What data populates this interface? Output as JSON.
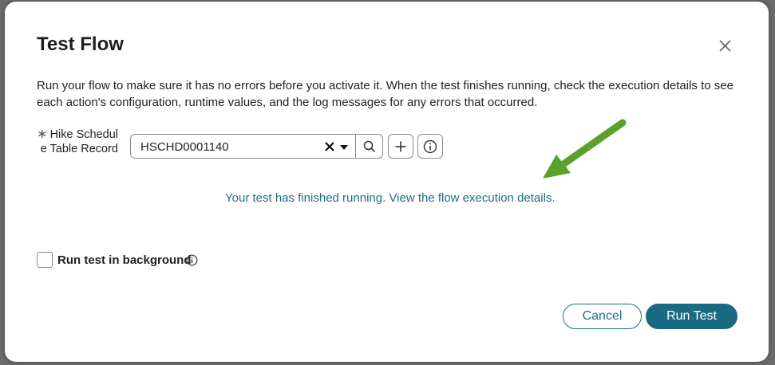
{
  "dialog": {
    "title": "Test Flow",
    "description": "Run your flow to make sure it has no errors before you activate it. When the test finishes running, check the execution details to see each action's configuration, runtime values, and the log messages for any errors that occurred.",
    "field": {
      "required_marker": "∗",
      "label": "Hike Schedule Table Record",
      "value": "HSCHD0001140"
    },
    "status_message": "Your test has finished running. View the flow execution details.",
    "background_option": {
      "label": "Run test in background",
      "checked": false
    },
    "buttons": {
      "cancel": "Cancel",
      "run": "Run Test"
    }
  },
  "colors": {
    "accent": "#1b6a84",
    "link": "#1c6f86",
    "arrow": "#5aa02c"
  },
  "icons": [
    "close-icon",
    "clear-icon",
    "caret-down-icon",
    "search-icon",
    "plus-icon",
    "info-icon",
    "arrow-icon"
  ]
}
